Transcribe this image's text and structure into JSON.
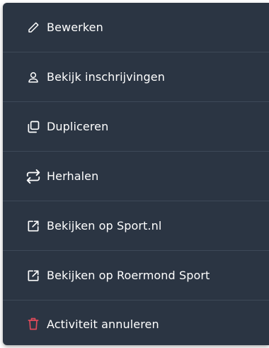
{
  "menu": {
    "items": [
      {
        "label": "Bewerken",
        "icon": "pencil-icon"
      },
      {
        "label": "Bekijk inschrijvingen",
        "icon": "user-icon"
      },
      {
        "label": "Dupliceren",
        "icon": "duplicate-icon"
      },
      {
        "label": "Herhalen",
        "icon": "repeat-icon"
      },
      {
        "label": "Bekijken op Sport.nl",
        "icon": "external-link-icon"
      },
      {
        "label": "Bekijken op Roermond Sport",
        "icon": "external-link-icon"
      },
      {
        "label": "Activiteit annuleren",
        "icon": "trash-icon",
        "color": "#e04a5a"
      }
    ]
  },
  "colors": {
    "background": "#2b3543",
    "text": "#ffffff",
    "danger": "#e04a5a",
    "divider": "#3e4958"
  }
}
